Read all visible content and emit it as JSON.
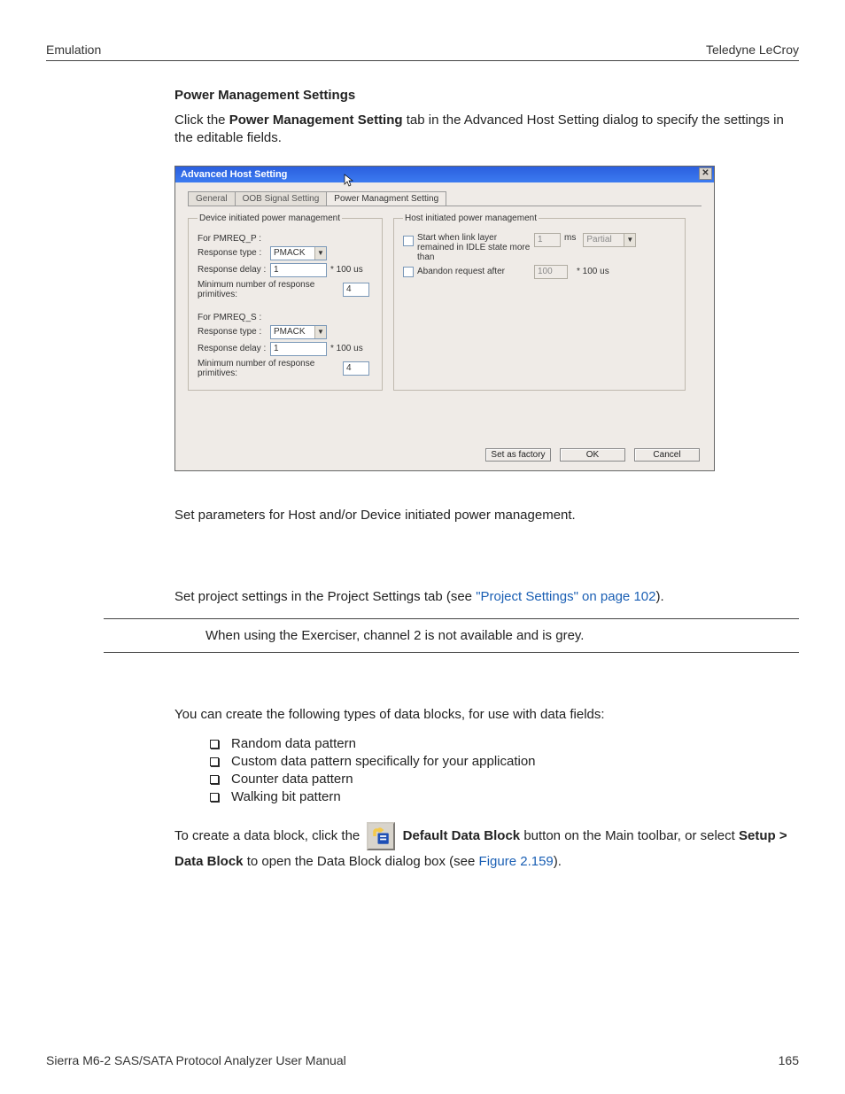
{
  "header": {
    "left": "Emulation",
    "right": "Teledyne LeCroy"
  },
  "section_heading": "Power Management Settings",
  "intro": {
    "pre": "Click the ",
    "bold": "Power Management Setting",
    "post": " tab in the Advanced Host Setting dialog to specify the settings in the editable fields."
  },
  "dialog": {
    "title": "Advanced Host Setting",
    "close": "✕",
    "tabs": {
      "t1": "General",
      "t2": "OOB Signal Setting",
      "t3": "Power Managment Setting"
    },
    "left_legend": "Device initiated power management",
    "right_legend": "Host initiated power management",
    "p_label": "For PMREQ_P :",
    "s_label": "For PMREQ_S :",
    "resp_type": "Response type :",
    "resp_delay": "Response delay :",
    "min_prim": "Minimum number of response primitives:",
    "pmack": "PMACK",
    "val1": "1",
    "val4": "4",
    "unit100us": "* 100 us",
    "chk1_label": "Start when link layer remained in IDLE state more than",
    "chk2_label": "Abandon request after",
    "val100": "100",
    "ms": "ms",
    "partial": "Partial",
    "btns": {
      "factory": "Set as factory",
      "ok": "OK",
      "cancel": "Cancel"
    }
  },
  "after_ss": "Set parameters for Host and/or Device initiated power management.",
  "project_line": {
    "pre": "Set project settings in the Project Settings tab (see ",
    "link": "\"Project Settings\" on page 102",
    "post": ")."
  },
  "note": "When using the Exerciser, channel 2 is not available and is grey.",
  "blocks_intro": "You can create the following types of data blocks, for use with data fields:",
  "blocks": [
    "Random data pattern",
    "Custom data pattern specifically for your application",
    "Counter data pattern",
    "Walking bit pattern"
  ],
  "create": {
    "pre": "To create a data block, click the ",
    "btn_bold": " Default Data Block",
    "post1": " button on the Main toolbar, or select ",
    "menu_bold": "Setup > Data Block",
    "post2": " to open the Data Block dialog box (see ",
    "fig_link": "Figure 2.159",
    "post3": ")."
  },
  "footer": {
    "left": "Sierra M6-2 SAS/SATA Protocol Analyzer User Manual",
    "right": "165"
  }
}
